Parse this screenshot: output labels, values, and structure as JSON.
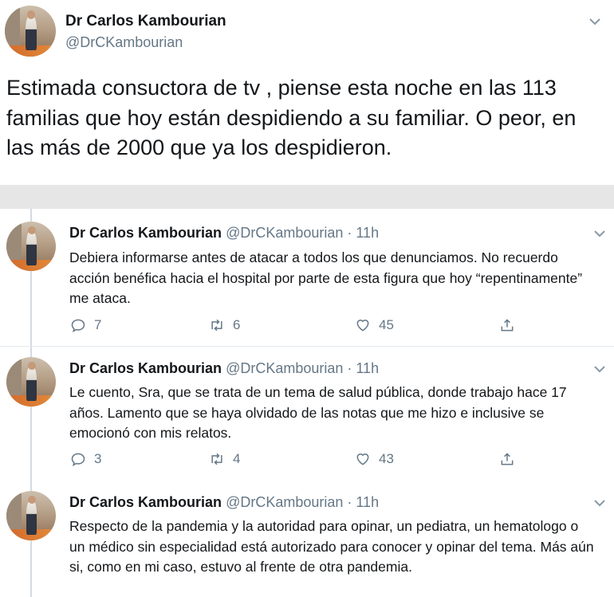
{
  "main_tweet": {
    "name": "Dr Carlos Kambourian",
    "handle": "@DrCKambourian",
    "text": "Estimada consuctora de tv , piense esta noche en las 113 familias que hoy están despidiendo a su familiar. O peor, en las más de 2000 que ya los despidieron."
  },
  "replies": [
    {
      "name": "Dr Carlos Kambourian",
      "meta": "@DrCKambourian · 11h",
      "text": "Debiera informarse antes de atacar a todos los que denunciamos. No recuerdo acción benéfica hacia el hospital por parte de esta figura que hoy “repentinamente” me ataca.",
      "replies_count": "7",
      "retweets_count": "6",
      "likes_count": "45"
    },
    {
      "name": "Dr Carlos Kambourian",
      "meta": "@DrCKambourian · 11h",
      "text": "Le cuento, Sra, que se trata de un tema de salud pública, donde trabajo hace 17 años. Lamento que se haya olvidado de las notas que me hizo e inclusive se emocionó con mis relatos.",
      "replies_count": "3",
      "retweets_count": "4",
      "likes_count": "43"
    },
    {
      "name": "Dr Carlos Kambourian",
      "meta": "@DrCKambourian · 11h",
      "text": "Respecto de la pandemia y  la autoridad para opinar, un pediatra, un hematologo o un médico sin especialidad está autorizado para conocer y opinar del tema. Más aún si, como en mi caso, estuvo al frente de otra pandemia."
    }
  ],
  "icons": {
    "reply": "reply-icon",
    "retweet": "retweet-icon",
    "like": "heart-icon",
    "share": "share-icon",
    "more": "chevron-down-icon"
  },
  "colors": {
    "text": "#14171a",
    "secondary": "#657786",
    "separator": "#e6e6e6"
  }
}
